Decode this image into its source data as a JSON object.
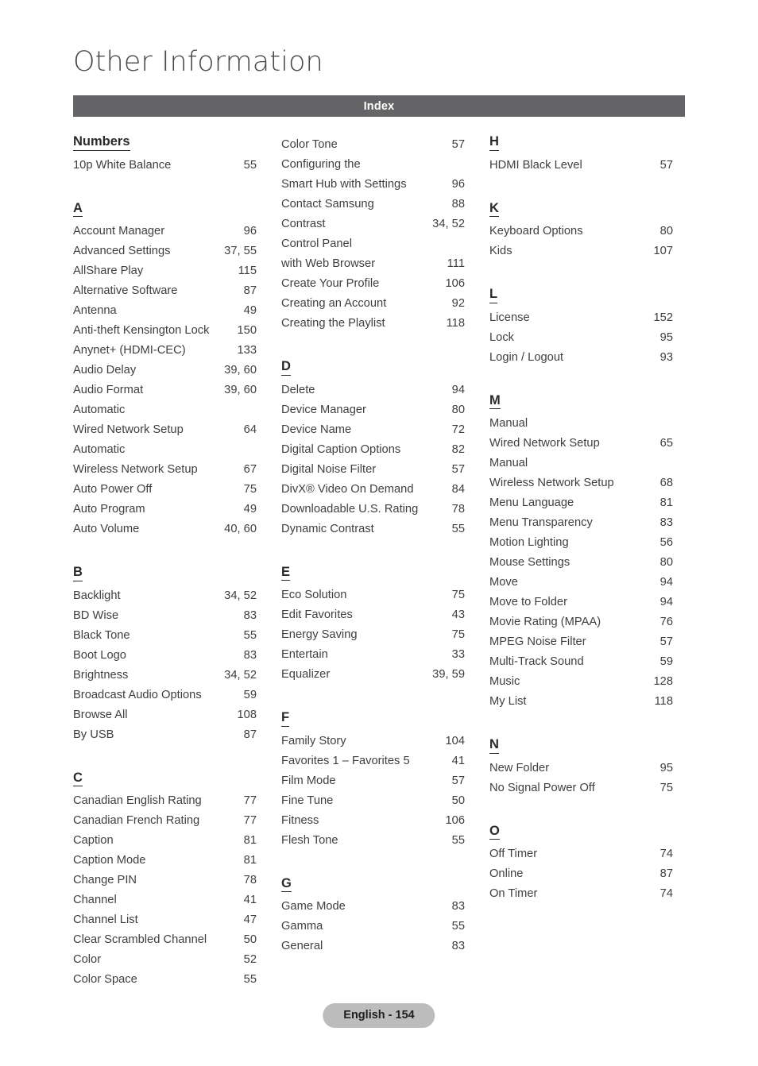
{
  "header": {
    "title": "Other Information",
    "index_bar_label": "Index"
  },
  "footer": {
    "page_label": "English - 154"
  },
  "colors": {
    "index_bar_background": "#656466",
    "index_bar_text": "#ffffff",
    "footer_pill_background": "#bcbcbc",
    "body_text": "#3f3f3f",
    "title_text": "#4a4a4a"
  },
  "columns": [
    {
      "sections": [
        {
          "letter": "Numbers",
          "entries": [
            {
              "label": "10p White Balance",
              "pages": "55"
            }
          ]
        },
        {
          "letter": "A",
          "entries": [
            {
              "label": "Account Manager",
              "pages": "96"
            },
            {
              "label": "Advanced Settings",
              "pages": "37, 55"
            },
            {
              "label": "AllShare Play",
              "pages": "115"
            },
            {
              "label": "Alternative Software",
              "pages": "87"
            },
            {
              "label": "Antenna",
              "pages": "49"
            },
            {
              "label": "Anti-theft Kensington Lock",
              "pages": "150"
            },
            {
              "label": "Anynet+ (HDMI-CEC)",
              "pages": "133"
            },
            {
              "label": "Audio Delay",
              "pages": "39, 60"
            },
            {
              "label": "Audio Format",
              "pages": "39, 60"
            },
            {
              "label": "Automatic",
              "label2": "Wired Network Setup",
              "pages": "64"
            },
            {
              "label": "Automatic",
              "label2": "Wireless Network Setup",
              "pages": "67"
            },
            {
              "label": "Auto Power Off",
              "pages": "75"
            },
            {
              "label": "Auto Program",
              "pages": "49"
            },
            {
              "label": "Auto Volume",
              "pages": "40, 60"
            }
          ]
        },
        {
          "letter": "B",
          "entries": [
            {
              "label": "Backlight",
              "pages": "34, 52"
            },
            {
              "label": "BD Wise",
              "pages": "83"
            },
            {
              "label": "Black Tone",
              "pages": "55"
            },
            {
              "label": "Boot Logo",
              "pages": "83"
            },
            {
              "label": "Brightness",
              "pages": "34, 52"
            },
            {
              "label": "Broadcast Audio Options",
              "pages": "59"
            },
            {
              "label": "Browse All",
              "pages": "108"
            },
            {
              "label": "By USB",
              "pages": "87"
            }
          ]
        },
        {
          "letter": "C",
          "entries": [
            {
              "label": "Canadian English Rating",
              "pages": "77"
            },
            {
              "label": "Canadian French Rating",
              "pages": "77"
            },
            {
              "label": "Caption",
              "pages": "81"
            },
            {
              "label": "Caption Mode",
              "pages": "81"
            },
            {
              "label": "Change PIN",
              "pages": "78"
            },
            {
              "label": "Channel",
              "pages": "41"
            },
            {
              "label": "Channel List",
              "pages": "47"
            },
            {
              "label": "Clear Scrambled Channel",
              "pages": "50"
            },
            {
              "label": "Color",
              "pages": "52"
            },
            {
              "label": "Color Space",
              "pages": "55"
            }
          ]
        }
      ]
    },
    {
      "sections": [
        {
          "letter": "",
          "entries": [
            {
              "label": "Color Tone",
              "pages": "57"
            },
            {
              "label": "Configuring the",
              "label2": "Smart Hub with Settings",
              "pages": "96"
            },
            {
              "label": "Contact Samsung",
              "pages": "88"
            },
            {
              "label": "Contrast",
              "pages": "34, 52"
            },
            {
              "label": "Control Panel",
              "label2": "with Web Browser",
              "pages": "111"
            },
            {
              "label": "Create Your Profile",
              "pages": "106"
            },
            {
              "label": "Creating an Account",
              "pages": "92"
            },
            {
              "label": "Creating the Playlist",
              "pages": "118"
            }
          ]
        },
        {
          "letter": "D",
          "entries": [
            {
              "label": "Delete",
              "pages": "94"
            },
            {
              "label": "Device Manager",
              "pages": "80"
            },
            {
              "label": "Device Name",
              "pages": "72"
            },
            {
              "label": "Digital Caption Options",
              "pages": "82"
            },
            {
              "label": "Digital Noise Filter",
              "pages": "57"
            },
            {
              "label": "DivX® Video On Demand",
              "pages": "84"
            },
            {
              "label": "Downloadable U.S. Rating",
              "pages": "78"
            },
            {
              "label": "Dynamic Contrast",
              "pages": "55"
            }
          ]
        },
        {
          "letter": "E",
          "entries": [
            {
              "label": "Eco Solution",
              "pages": "75"
            },
            {
              "label": "Edit Favorites",
              "pages": "43"
            },
            {
              "label": "Energy Saving",
              "pages": "75"
            },
            {
              "label": "Entertain",
              "pages": "33"
            },
            {
              "label": "Equalizer",
              "pages": "39, 59"
            }
          ]
        },
        {
          "letter": "F",
          "entries": [
            {
              "label": "Family Story",
              "pages": "104"
            },
            {
              "label": "Favorites 1 – Favorites 5",
              "pages": "41"
            },
            {
              "label": "Film Mode",
              "pages": "57"
            },
            {
              "label": "Fine Tune",
              "pages": "50"
            },
            {
              "label": "Fitness",
              "pages": "106"
            },
            {
              "label": "Flesh Tone",
              "pages": "55"
            }
          ]
        },
        {
          "letter": "G",
          "entries": [
            {
              "label": "Game Mode",
              "pages": "83"
            },
            {
              "label": "Gamma",
              "pages": "55"
            },
            {
              "label": "General",
              "pages": "83"
            }
          ]
        }
      ]
    },
    {
      "sections": [
        {
          "letter": "H",
          "entries": [
            {
              "label": "HDMI Black Level",
              "pages": "57"
            }
          ]
        },
        {
          "letter": "K",
          "entries": [
            {
              "label": "Keyboard Options",
              "pages": "80"
            },
            {
              "label": "Kids",
              "pages": "107"
            }
          ]
        },
        {
          "letter": "L",
          "entries": [
            {
              "label": "License",
              "pages": "152"
            },
            {
              "label": "Lock",
              "pages": "95"
            },
            {
              "label": "Login / Logout",
              "pages": "93"
            }
          ]
        },
        {
          "letter": "M",
          "entries": [
            {
              "label": "Manual",
              "label2": "Wired Network Setup",
              "pages": "65"
            },
            {
              "label": "Manual",
              "label2": "Wireless Network Setup",
              "pages": "68"
            },
            {
              "label": "Menu Language",
              "pages": "81"
            },
            {
              "label": "Menu Transparency",
              "pages": "83"
            },
            {
              "label": "Motion Lighting",
              "pages": "56"
            },
            {
              "label": "Mouse Settings",
              "pages": "80"
            },
            {
              "label": "Move",
              "pages": "94"
            },
            {
              "label": "Move to Folder",
              "pages": "94"
            },
            {
              "label": "Movie Rating (MPAA)",
              "pages": "76"
            },
            {
              "label": "MPEG Noise Filter",
              "pages": "57"
            },
            {
              "label": "Multi-Track Sound",
              "pages": "59"
            },
            {
              "label": "Music",
              "pages": "128"
            },
            {
              "label": "My List",
              "pages": "118"
            }
          ]
        },
        {
          "letter": "N",
          "entries": [
            {
              "label": "New Folder",
              "pages": "95"
            },
            {
              "label": "No Signal Power Off",
              "pages": "75"
            }
          ]
        },
        {
          "letter": "O",
          "entries": [
            {
              "label": "Off Timer",
              "pages": "74"
            },
            {
              "label": "Online",
              "pages": "87"
            },
            {
              "label": "On Timer",
              "pages": "74"
            }
          ]
        }
      ]
    }
  ]
}
